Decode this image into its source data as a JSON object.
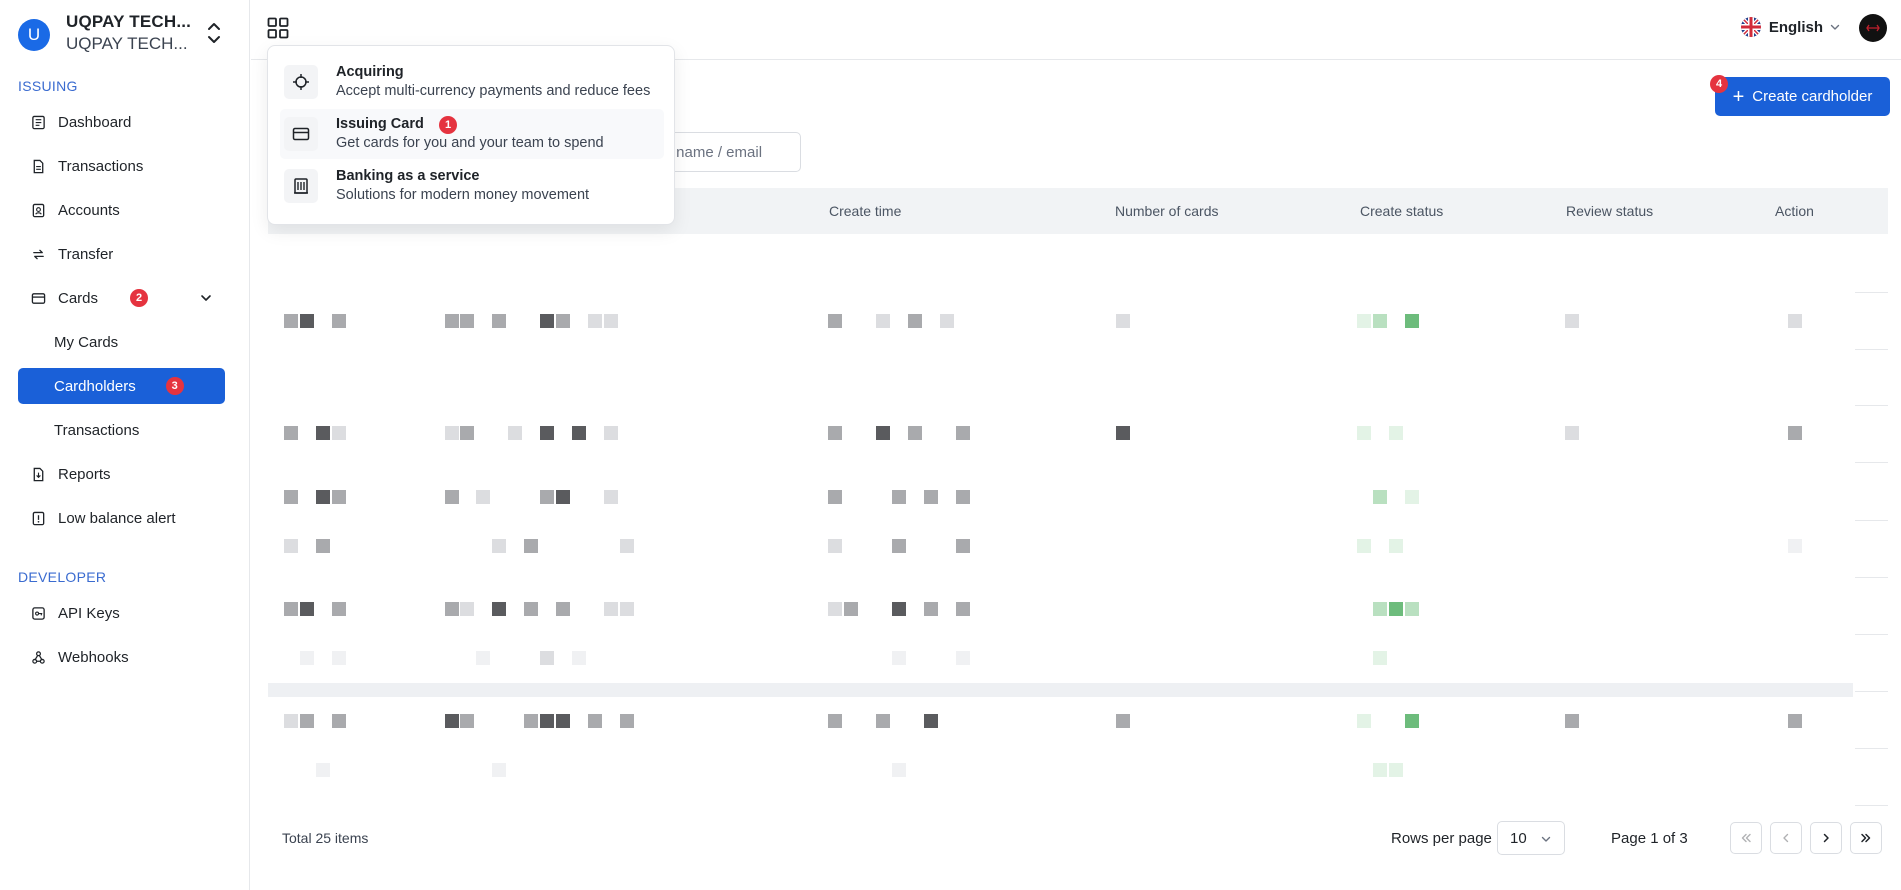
{
  "org": {
    "avatar_letter": "U",
    "name": "UQPAY TECH...",
    "sub_name": "UQPAY TECH..."
  },
  "sidebar": {
    "issuing_label": "ISSUING",
    "developer_label": "DEVELOPER",
    "items": [
      {
        "label": "Dashboard",
        "icon": "dashboard-icon"
      },
      {
        "label": "Transactions",
        "icon": "document-icon"
      },
      {
        "label": "Accounts",
        "icon": "accounts-icon"
      },
      {
        "label": "Transfer",
        "icon": "transfer-icon"
      },
      {
        "label": "Cards",
        "icon": "card-icon",
        "badge": "2"
      },
      {
        "label": "My Cards"
      },
      {
        "label": "Cardholders",
        "badge": "3",
        "active": true
      },
      {
        "label": "Transactions"
      },
      {
        "label": "Reports",
        "icon": "report-icon"
      },
      {
        "label": "Low balance alert",
        "icon": "alert-icon"
      }
    ],
    "dev_items": [
      {
        "label": "API Keys",
        "icon": "key-icon"
      },
      {
        "label": "Webhooks",
        "icon": "webhook-icon"
      }
    ]
  },
  "topbar": {
    "language": "English",
    "flag_icon": "uk-flag-icon"
  },
  "menu": {
    "items": [
      {
        "title": "Acquiring",
        "desc": "Accept multi-currency payments and reduce fees",
        "icon": "crosshair-icon"
      },
      {
        "title": "Issuing Card",
        "desc": "Get cards for you and your team to spend",
        "icon": "credit-card-icon",
        "badge": "1"
      },
      {
        "title": "Banking as a service",
        "desc": "Solutions for modern money movement",
        "icon": "bank-icon"
      }
    ]
  },
  "actions": {
    "create_label": "Create cardholder",
    "create_badge": "4"
  },
  "search": {
    "placeholder": "r name / email"
  },
  "table": {
    "headers": [
      "Create time",
      "Number of cards",
      "Create status",
      "Review status",
      "Action"
    ]
  },
  "footer": {
    "total": "Total 25 items",
    "rows_per_page_label": "Rows per page",
    "rows_per_page_value": "10",
    "page_info": "Page 1 of 3"
  },
  "colors": {
    "primary": "#1a60d8",
    "badge": "#e5333f",
    "section": "#3a6bd0"
  }
}
